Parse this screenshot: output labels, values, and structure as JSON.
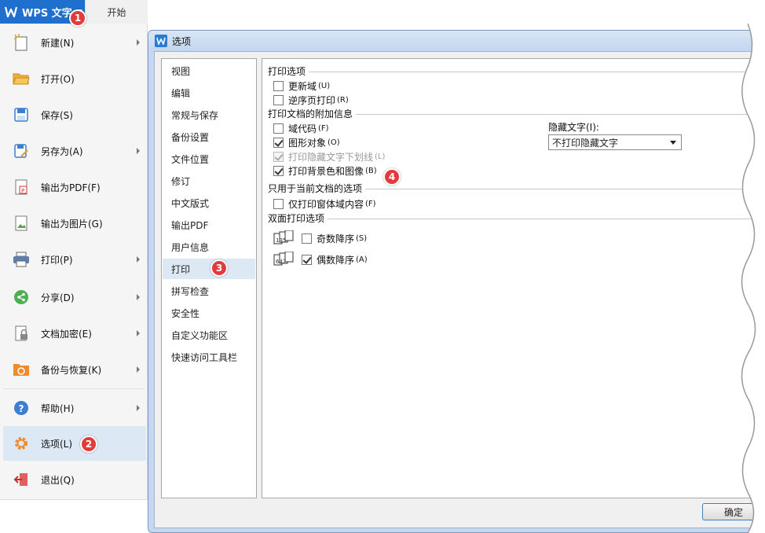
{
  "app": {
    "name": "WPS 文字",
    "tab_start": "开始"
  },
  "file_menu": {
    "items": [
      {
        "label": "新建(N)",
        "icon": "new-doc-icon",
        "has_arrow": true
      },
      {
        "label": "打开(O)",
        "icon": "folder-open-icon",
        "has_arrow": false
      },
      {
        "label": "保存(S)",
        "icon": "save-icon",
        "has_arrow": false
      },
      {
        "label": "另存为(A)",
        "icon": "save-as-icon",
        "has_arrow": true
      },
      {
        "label": "输出为PDF(F)",
        "icon": "pdf-icon",
        "has_arrow": false
      },
      {
        "label": "输出为图片(G)",
        "icon": "image-export-icon",
        "has_arrow": false
      },
      {
        "label": "打印(P)",
        "icon": "printer-icon",
        "has_arrow": true
      },
      {
        "label": "分享(D)",
        "icon": "share-icon",
        "has_arrow": true
      },
      {
        "label": "文档加密(E)",
        "icon": "lock-doc-icon",
        "has_arrow": true
      },
      {
        "label": "备份与恢复(K)",
        "icon": "backup-icon",
        "has_arrow": true
      },
      {
        "label": "帮助(H)",
        "icon": "help-icon",
        "has_arrow": true
      },
      {
        "label": "选项(L)",
        "icon": "gear-icon",
        "has_arrow": false,
        "selected": true
      },
      {
        "label": "退出(Q)",
        "icon": "exit-icon",
        "has_arrow": false
      }
    ]
  },
  "badges": [
    "1",
    "2",
    "3",
    "4"
  ],
  "dialog": {
    "title": "选项",
    "categories": [
      "视图",
      "编辑",
      "常规与保存",
      "备份设置",
      "文件位置",
      "修订",
      "中文版式",
      "输出PDF",
      "用户信息",
      "打印",
      "拼写检查",
      "安全性",
      "自定义功能区",
      "快速访问工具栏"
    ],
    "selected_category": "打印",
    "groups": {
      "print_options": {
        "title": "打印选项",
        "options": [
          {
            "label": "更新域",
            "shortcut": "(U)",
            "checked": false,
            "disabled": false
          },
          {
            "label": "逆序页打印",
            "shortcut": "(R)",
            "checked": false,
            "disabled": false
          }
        ]
      },
      "extra_info": {
        "title": "打印文档的附加信息",
        "options": [
          {
            "label": "域代码",
            "shortcut": "(F)",
            "checked": false,
            "disabled": false
          },
          {
            "label": "图形对象",
            "shortcut": "(O)",
            "checked": true,
            "disabled": false
          },
          {
            "label": "打印隐藏文字下划线",
            "shortcut": "(L)",
            "checked": true,
            "disabled": true
          },
          {
            "label": "打印背景色和图像",
            "shortcut": "(B)",
            "checked": true,
            "disabled": false
          }
        ],
        "hidden_text_label": "隐藏文字(I):",
        "hidden_text_value": "不打印隐藏文字"
      },
      "current_doc": {
        "title": "只用于当前文档的选项",
        "options": [
          {
            "label": "仅打印窗体域内容",
            "shortcut": "(F)",
            "checked": false,
            "disabled": false
          }
        ]
      },
      "duplex": {
        "title": "双面打印选项",
        "options": [
          {
            "label": "奇数降序",
            "shortcut": "(S)",
            "checked": false,
            "pages": "135"
          },
          {
            "label": "偶数降序",
            "shortcut": "(A)",
            "checked": true,
            "pages": "642"
          }
        ]
      }
    },
    "ok_label": "确定"
  },
  "colors": {
    "accent": "#1f6fce",
    "badge": "#e23b3b",
    "selection": "#dde8f5",
    "dialog_frame": "#c6d8ef"
  }
}
